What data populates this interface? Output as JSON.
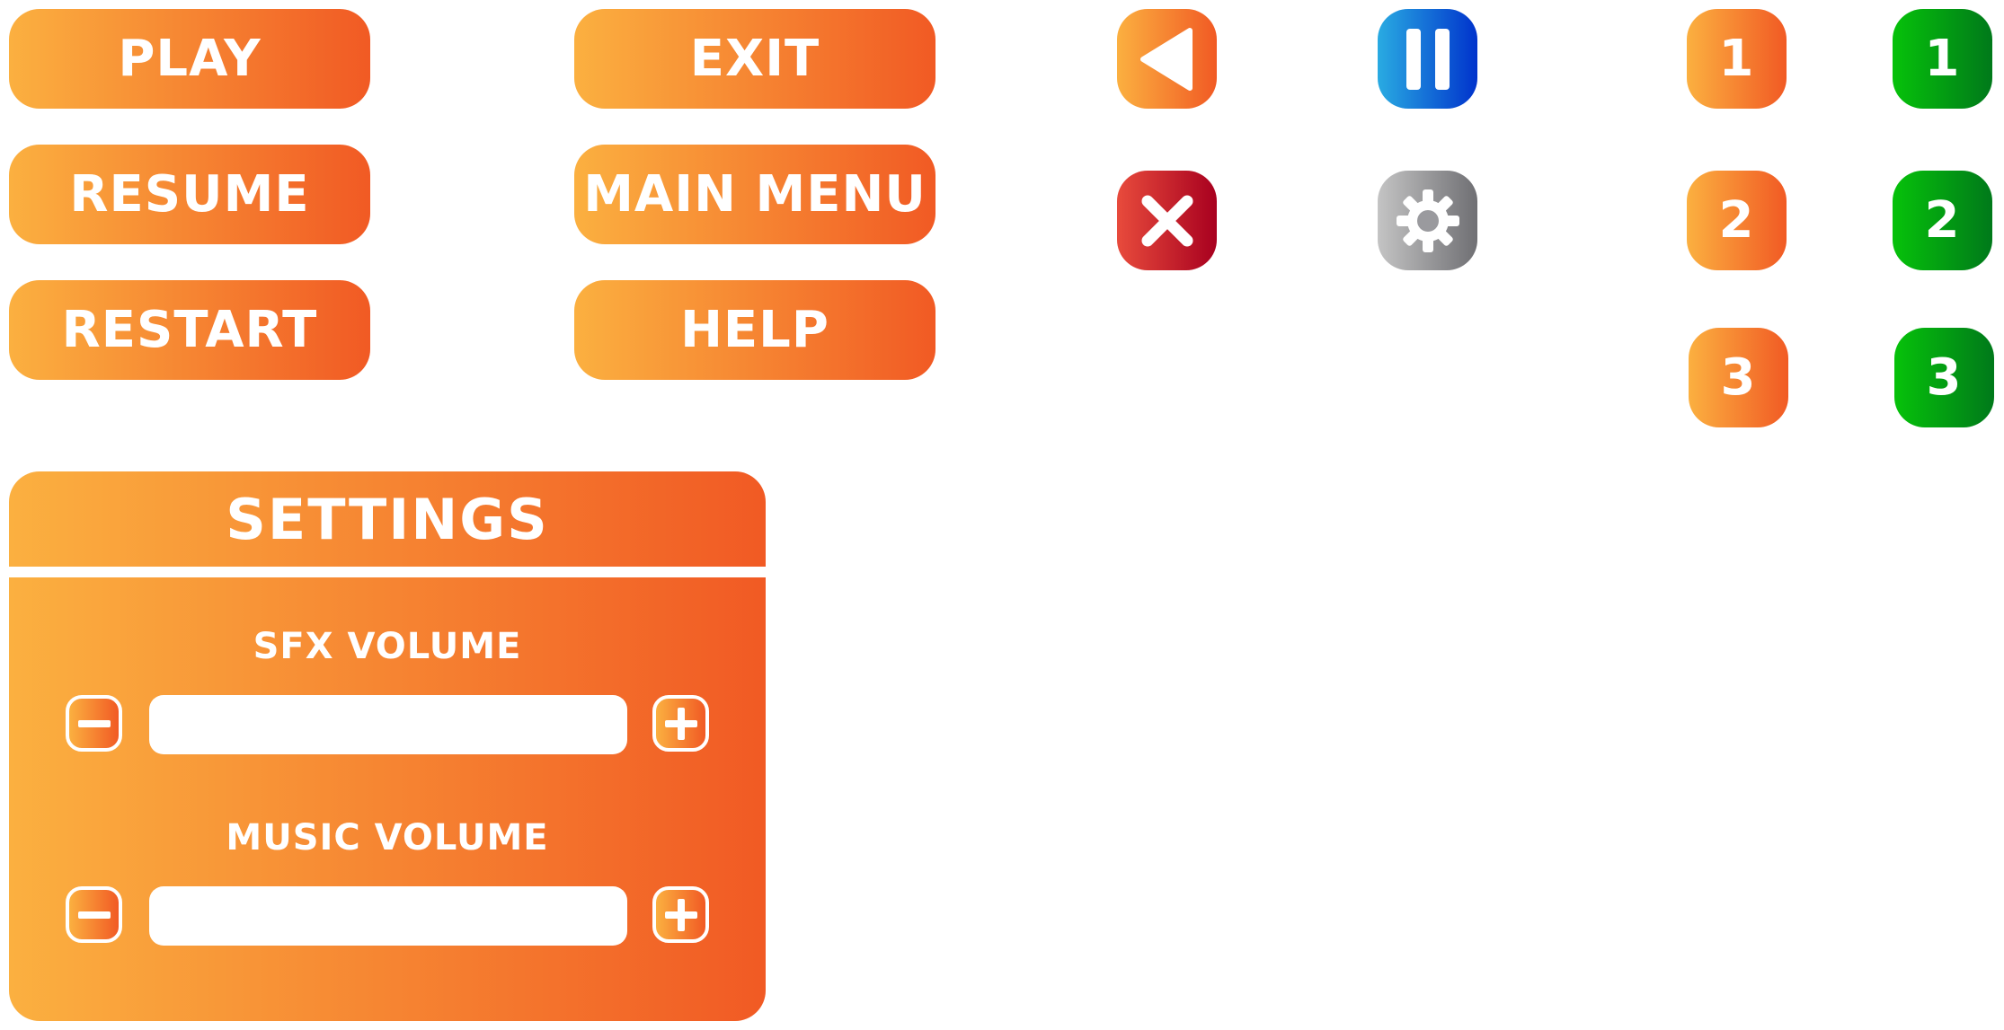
{
  "colors": {
    "orange_start": "#fbb040",
    "orange_end": "#f15a24",
    "blue_start": "#29abe2",
    "blue_end": "#0033cc",
    "red_start": "#e84b3c",
    "red_end": "#a8001f",
    "gray_start": "#c4c4c4",
    "gray_end": "#6f6f73",
    "green_start": "#06c20a",
    "green_end": "#00791a",
    "text": "#ffffff"
  },
  "menu": {
    "play": "PLAY",
    "exit": "EXIT",
    "resume": "RESUME",
    "main_menu": "MAIN MENU",
    "restart": "RESTART",
    "help": "HELP"
  },
  "icons": {
    "back": "back-triangle-icon",
    "pause": "pause-icon",
    "close": "close-x-icon",
    "settings": "gear-icon"
  },
  "levels": {
    "orange": [
      "1",
      "2",
      "3"
    ],
    "green": [
      "1",
      "2",
      "3"
    ]
  },
  "settings": {
    "title": "SETTINGS",
    "sfx_label": "SFX VOLUME",
    "music_label": "MUSIC VOLUME",
    "sfx_level": 0,
    "music_level": 0
  }
}
